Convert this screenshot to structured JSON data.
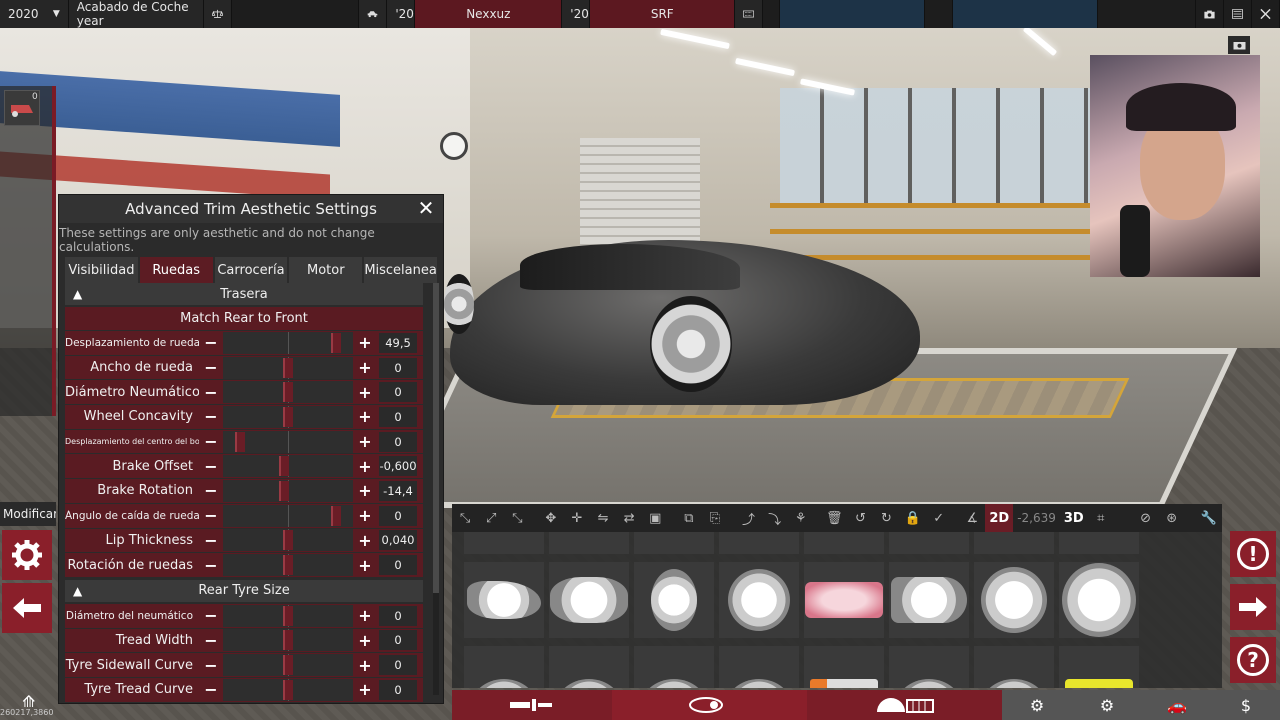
{
  "topbar": {
    "year": "2020",
    "year_dropdown": "▼",
    "trim_name": "Acabado de Coche year",
    "scale_icon": "scale-icon",
    "car_icon": "car-icon",
    "model_year": "'20",
    "model_name": "Nexxuz",
    "trim_year": "'20",
    "trim_code": "SRF",
    "accent_color": "#5c1820"
  },
  "leftstrip": {
    "count": "0"
  },
  "panel": {
    "title": "Advanced Trim Aesthetic Settings",
    "close": "✕",
    "note": "These settings are only aesthetic and do not change calculations.",
    "tabs": [
      {
        "label": "Visibilidad",
        "active": false
      },
      {
        "label": "Ruedas",
        "active": true
      },
      {
        "label": "Carrocería",
        "active": false
      },
      {
        "label": "Motor",
        "active": false
      },
      {
        "label": "Miscelanea",
        "active": false
      }
    ],
    "section1": {
      "triangle": "▲",
      "title": "Trasera"
    },
    "match_label": "Match Rear to Front",
    "rows": [
      {
        "label": "Desplazamiento de rueda",
        "value": "49,5",
        "level": 0.9,
        "small": true
      },
      {
        "label": "Ancho de rueda",
        "value": "0",
        "level": 0.5,
        "small": false
      },
      {
        "label": "Diámetro Neumático",
        "value": "0",
        "level": 0.5,
        "small": false
      },
      {
        "label": "Wheel Concavity",
        "value": "0",
        "level": 0.5,
        "small": false
      },
      {
        "label": "Desplazamiento del centro del borde",
        "value": "0",
        "level": 0.1,
        "small": true
      },
      {
        "label": "Brake Offset",
        "value": "-0,600",
        "level": 0.47,
        "small": false
      },
      {
        "label": "Brake Rotation",
        "value": "-14,4",
        "level": 0.47,
        "small": false
      },
      {
        "label": "Ángulo de caída de rueda",
        "value": "0",
        "level": 0.9,
        "small": true
      },
      {
        "label": "Lip Thickness",
        "value": "0,040",
        "level": 0.5,
        "small": false
      },
      {
        "label": "Rotación de ruedas",
        "value": "0",
        "level": 0.5,
        "small": false
      }
    ],
    "section2": {
      "triangle": "▲",
      "title": "Rear Tyre Size"
    },
    "rows2": [
      {
        "label": "Diámetro del neumático",
        "value": "0",
        "level": 0.5,
        "small": true
      },
      {
        "label": "Tread Width",
        "value": "0",
        "level": 0.5,
        "small": false
      },
      {
        "label": "Tyre Sidewall Curve",
        "value": "0",
        "level": 0.5,
        "small": false
      },
      {
        "label": "Tyre Tread Curve",
        "value": "0",
        "level": 0.5,
        "small": false
      }
    ],
    "minus": "−",
    "plus": "+"
  },
  "left": {
    "modif_label": "Modificar",
    "gear_icon": "⚙",
    "back_icon": "🡐",
    "coords": "260217,3860"
  },
  "toolbar": {
    "angle_value": "-2,639",
    "label_2d": "2D",
    "label_3d": "3D"
  },
  "right": {
    "info_icon": "!",
    "next_icon": "🡒",
    "help_icon": "?"
  }
}
